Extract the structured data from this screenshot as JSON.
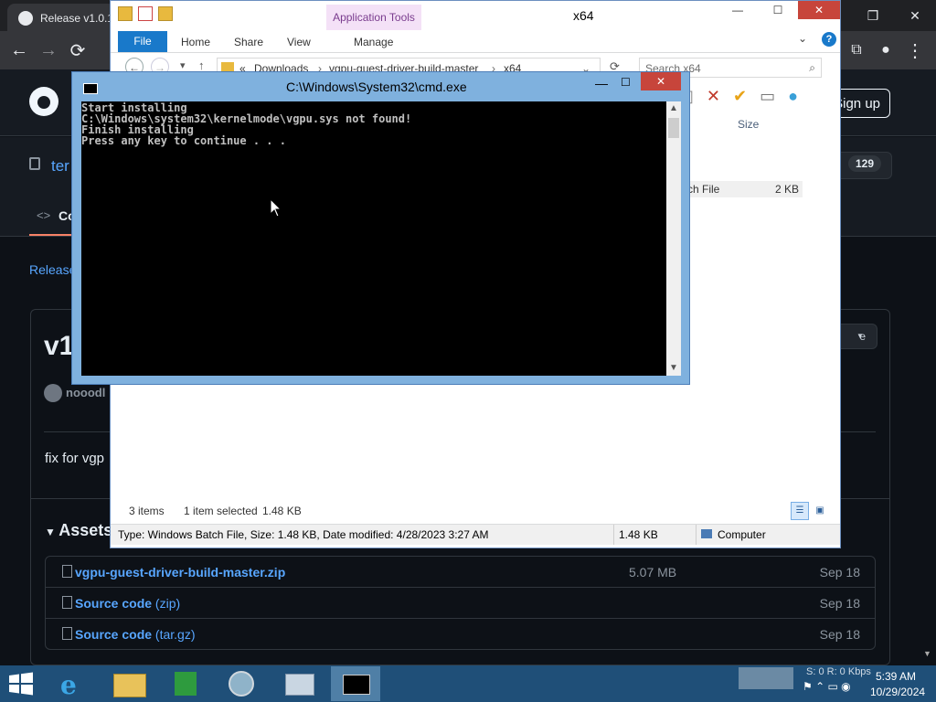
{
  "browser": {
    "tab_title": "Release v1.0.1",
    "window_controls": [
      "—",
      "❐",
      "✕"
    ],
    "nav": {
      "back": "←",
      "forward": "→",
      "reload": "⟳"
    },
    "toolbar_right": [
      "⧉",
      "●",
      "⋮"
    ]
  },
  "github": {
    "signup": "Sign up",
    "repo_name_visible": "ter",
    "star_count": "129",
    "star_partial": "r",
    "code_tab": "Co",
    "releases_link": "Release",
    "release_title": "v1",
    "release_author": "nooodl",
    "release_dropdown": "e",
    "release_body": "fix for vgp",
    "assets_heading": "Assets",
    "assets": [
      {
        "name": "vgpu-guest-driver-build-master.zip",
        "name_suffix": "",
        "size": "5.07 MB",
        "date": "Sep 18"
      },
      {
        "name": "Source code",
        "name_suffix": " (zip)",
        "size": "",
        "date": "Sep 18"
      },
      {
        "name": "Source code",
        "name_suffix": " (tar.gz)",
        "size": "",
        "date": "Sep 18"
      }
    ]
  },
  "explorer": {
    "title": "x64",
    "app_tools": "Application Tools",
    "ribbon": {
      "file": "File",
      "home": "Home",
      "share": "Share",
      "view": "View",
      "manage": "Manage"
    },
    "address": {
      "root": "«",
      "seg1": "Downloads",
      "seg2": "vgpu-guest-driver-build-master",
      "seg3": "x64"
    },
    "search_placeholder": "Search x64",
    "column_size": "Size",
    "partial_row": {
      "type": "ch File",
      "size": "2 KB"
    },
    "status": {
      "items": "3 items",
      "selected": "1 item selected",
      "size": "1.48 KB"
    },
    "details": {
      "info": "Type: Windows Batch File, Size: 1.48 KB, Date modified: 4/28/2023 3:27 AM",
      "size": "1.48 KB",
      "location": "Computer"
    }
  },
  "cmd": {
    "title": "C:\\Windows\\System32\\cmd.exe",
    "output": "Start installing\nC:\\Windows\\system32\\kernelmode\\vgpu.sys not found!\nFinish installing\nPress any key to continue . . ."
  },
  "taskbar": {
    "tray_speed": "S: 0 R: 0 Kbps",
    "time": "5:39 AM",
    "date": "10/29/2024"
  },
  "colors": {
    "gh_bg": "#0d1117",
    "link": "#58a6ff",
    "taskbar": "#1f4f78",
    "cmd_frame": "#7fb1de",
    "close_red": "#c7453b"
  }
}
